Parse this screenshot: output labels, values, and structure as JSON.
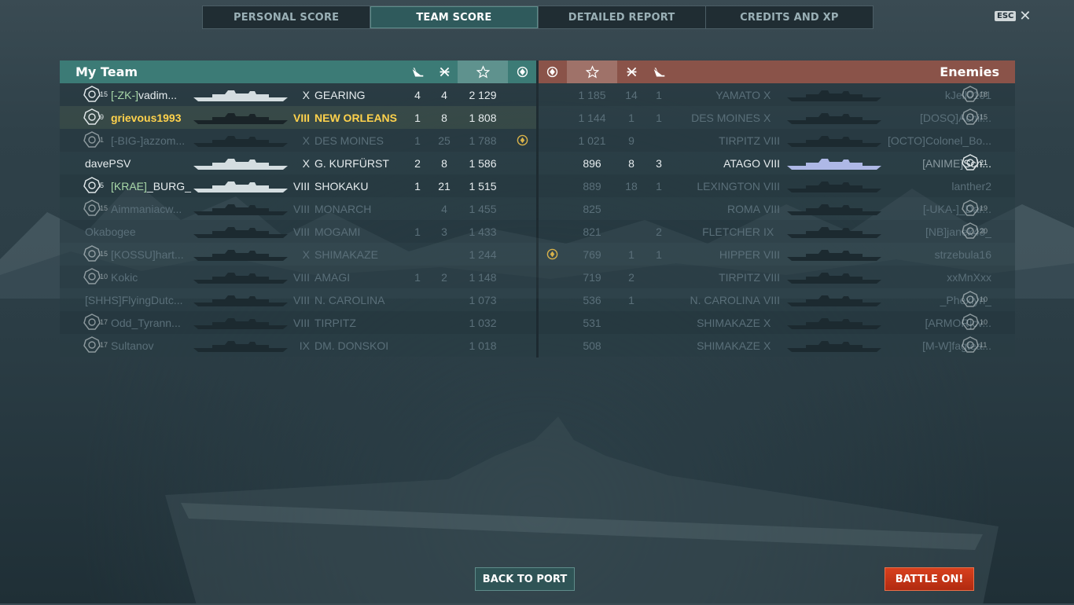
{
  "tabs": [
    {
      "label": "PERSONAL SCORE",
      "active": false
    },
    {
      "label": "TEAM SCORE",
      "active": true
    },
    {
      "label": "DETAILED REPORT",
      "active": false
    },
    {
      "label": "CREDITS AND XP",
      "active": false
    }
  ],
  "esc": {
    "key": "ESC",
    "close": "✕"
  },
  "my_team": {
    "title": "My Team",
    "rows": [
      {
        "level": "15",
        "clan": "[-ZK-]",
        "name": "vadim...",
        "tier": "X",
        "ship": "GEARING",
        "kills": "4",
        "damage": "4",
        "score": "2 129",
        "medal": false,
        "dim": false
      },
      {
        "level": "9",
        "clan": "",
        "name": "grievous1993",
        "tier": "VIII",
        "ship": "NEW ORLEANS",
        "kills": "1",
        "damage": "8",
        "score": "1 808",
        "medal": false,
        "dim": false,
        "me": true
      },
      {
        "level": "1",
        "clan": "[-BIG-]",
        "name": "azzom...",
        "tier": "X",
        "ship": "DES MOINES",
        "kills": "1",
        "damage": "25",
        "score": "1 788",
        "medal": true,
        "dim": true
      },
      {
        "level": "",
        "clan": "",
        "name": "davePSV",
        "tier": "X",
        "ship": "G. KURFÜRST",
        "kills": "2",
        "damage": "8",
        "score": "1 586",
        "medal": false,
        "dim": false
      },
      {
        "level": "5",
        "clan": "[KRAE]",
        "name": "_BURG_",
        "tier": "VIII",
        "ship": "SHOKAKU",
        "kills": "1",
        "damage": "21",
        "score": "1 515",
        "medal": false,
        "dim": false
      },
      {
        "level": "15",
        "clan": "",
        "name": "Aimmaniacw...",
        "tier": "VIII",
        "ship": "MONARCH",
        "kills": "",
        "damage": "4",
        "score": "1 455",
        "medal": false,
        "dim": true
      },
      {
        "level": "",
        "clan": "",
        "name": "Okabogee",
        "tier": "VIII",
        "ship": "MOGAMI",
        "kills": "1",
        "damage": "3",
        "score": "1 433",
        "medal": false,
        "dim": true
      },
      {
        "level": "15",
        "clan": "[KOSSU]",
        "name": "hart...",
        "tier": "X",
        "ship": "SHIMAKAZE",
        "kills": "",
        "damage": "",
        "score": "1 244",
        "medal": false,
        "dim": true
      },
      {
        "level": "10",
        "clan": "",
        "name": "Kokic",
        "tier": "VIII",
        "ship": "AMAGI",
        "kills": "1",
        "damage": "2",
        "score": "1 148",
        "medal": false,
        "dim": true
      },
      {
        "level": "",
        "clan": "[SHHS]",
        "name": "FlyingDutc...",
        "tier": "VIII",
        "ship": "N. CAROLINA",
        "kills": "",
        "damage": "",
        "score": "1 073",
        "medal": false,
        "dim": true
      },
      {
        "level": "17",
        "clan": "",
        "name": "Odd_Tyrann...",
        "tier": "VIII",
        "ship": "TIRPITZ",
        "kills": "",
        "damage": "",
        "score": "1 032",
        "medal": false,
        "dim": true
      },
      {
        "level": "17",
        "clan": "",
        "name": "Sultanov",
        "tier": "IX",
        "ship": "DM. DONSKOI",
        "kills": "",
        "damage": "",
        "score": "1 018",
        "medal": false,
        "dim": true
      }
    ]
  },
  "enemies": {
    "title": "Enemies",
    "rows": [
      {
        "score": "1 185",
        "damage": "14",
        "kills": "1",
        "ship": "YAMATO",
        "tier": "X",
        "clan": "",
        "name": "kJell0101",
        "level": "18",
        "medal": false,
        "dim": true
      },
      {
        "score": "1 144",
        "damage": "1",
        "kills": "1",
        "ship": "DES MOINES",
        "tier": "X",
        "clan": "[DOSQ]",
        "name": "Achil...",
        "level": "15",
        "medal": false,
        "dim": true
      },
      {
        "score": "1 021",
        "damage": "9",
        "kills": "",
        "ship": "TIRPITZ",
        "tier": "VIII",
        "clan": "[OCTO]",
        "name": "Colonel_Bo...",
        "level": "",
        "medal": false,
        "dim": true
      },
      {
        "score": "896",
        "damage": "8",
        "kills": "3",
        "ship": "ATAGO",
        "tier": "VIII",
        "clan": "[ANIME]",
        "name": "Sch...",
        "level": "21",
        "medal": false,
        "dim": false
      },
      {
        "score": "889",
        "damage": "18",
        "kills": "1",
        "ship": "LEXINGTON",
        "tier": "VIII",
        "clan": "",
        "name": "lanther2",
        "level": "",
        "medal": false,
        "dim": true
      },
      {
        "score": "825",
        "damage": "",
        "kills": "",
        "ship": "ROMA",
        "tier": "VIII",
        "clan": "[-UKA-]",
        "name": "_Dar...",
        "level": "19",
        "medal": false,
        "dim": true
      },
      {
        "score": "821",
        "damage": "",
        "kills": "2",
        "ship": "FLETCHER",
        "tier": "IX",
        "clan": "[NB]",
        "name": "janek43_",
        "level": "20",
        "medal": false,
        "dim": true
      },
      {
        "score": "769",
        "damage": "1",
        "kills": "1",
        "ship": "HIPPER",
        "tier": "VIII",
        "clan": "",
        "name": "strzebula16",
        "level": "",
        "medal": true,
        "dim": true
      },
      {
        "score": "719",
        "damage": "2",
        "kills": "",
        "ship": "TIRPITZ",
        "tier": "VIII",
        "clan": "",
        "name": "xxMnXxx",
        "level": "",
        "medal": false,
        "dim": true
      },
      {
        "score": "536",
        "damage": "1",
        "kills": "",
        "ship": "N. CAROLINA",
        "tier": "VIII",
        "clan": "",
        "name": "_Phexlyn_",
        "level": "10",
        "medal": false,
        "dim": true
      },
      {
        "score": "531",
        "damage": "",
        "kills": "",
        "ship": "SHIMAKAZE",
        "tier": "X",
        "clan": "[ARMOR]",
        "name": "cv...",
        "level": "10",
        "medal": false,
        "dim": true
      },
      {
        "score": "508",
        "damage": "",
        "kills": "",
        "ship": "SHIMAKAZE",
        "tier": "X",
        "clan": "[M-W]",
        "name": "fagtea...",
        "level": "11",
        "medal": false,
        "dim": true
      }
    ]
  },
  "buttons": {
    "back": "BACK TO PORT",
    "battle": "BATTLE ON!"
  },
  "colors": {
    "my_team_header": "#3c7b76",
    "enemy_header": "#8a5349",
    "active_tab": "#2f5a5c",
    "battle_button": "#c8351a",
    "highlight_player": "#ffd24c"
  }
}
